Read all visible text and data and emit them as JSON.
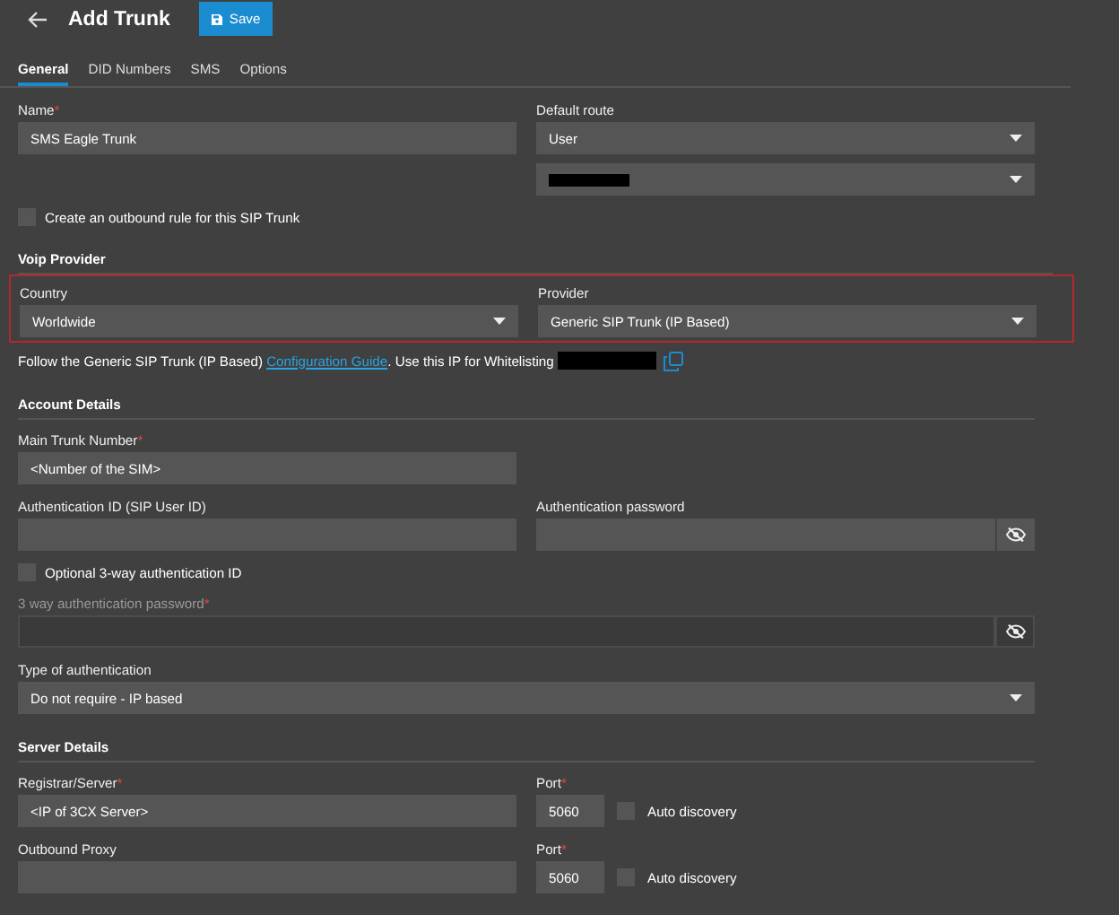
{
  "header": {
    "title": "Add Trunk",
    "save_label": "Save"
  },
  "required_marker": "*",
  "tabs": [
    {
      "label": "General",
      "selected": true
    },
    {
      "label": "DID Numbers",
      "selected": false
    },
    {
      "label": "SMS",
      "selected": false
    },
    {
      "label": "Options",
      "selected": false
    }
  ],
  "sections": [
    {
      "highlighted": false,
      "rows": [
        [
          {
            "kind": "text",
            "label": "Name",
            "required": true,
            "value": "SMS Eagle Trunk"
          },
          {
            "kind": "select",
            "label": "Default route",
            "required": false,
            "selects": [
              {
                "value": "User",
                "redacted": false
              },
              {
                "redacted": true
              }
            ]
          }
        ],
        [
          {
            "kind": "checkbox",
            "label": "Create an outbound rule for this SIP Trunk",
            "checked": false
          }
        ]
      ]
    },
    {
      "heading": "Voip Provider",
      "highlighted": true,
      "rows": [
        [
          {
            "kind": "select",
            "label": "Country",
            "required": false,
            "selects": [
              {
                "value": "Worldwide",
                "redacted": false
              }
            ]
          },
          {
            "kind": "select",
            "label": "Provider",
            "required": false,
            "selects": [
              {
                "value": "Generic SIP Trunk (IP Based)",
                "redacted": false
              }
            ]
          }
        ]
      ]
    },
    {
      "highlighted": false,
      "rows": [
        [
          {
            "kind": "note",
            "before": "Follow the Generic SIP Trunk (IP Based) ",
            "link": "Configuration Guide",
            "after": ". Use this IP for Whitelisting",
            "redacted": true
          }
        ]
      ]
    },
    {
      "heading": "Account Details",
      "highlighted": false,
      "rows": [
        [
          {
            "kind": "text",
            "label": "Main Trunk Number",
            "required": true,
            "value": "<Number of the SIM>"
          }
        ],
        [
          {
            "kind": "text",
            "label": "Authentication ID (SIP User ID)",
            "required": false
          },
          {
            "kind": "password",
            "label": "Authentication password",
            "required": false,
            "disabled": false,
            "wide": false
          }
        ],
        [
          {
            "kind": "checkbox",
            "label": "Optional 3-way authentication ID",
            "checked": false
          }
        ],
        [
          {
            "kind": "password",
            "label": "3 way authentication password",
            "required": true,
            "disabled": true,
            "wide": true
          }
        ],
        [
          {
            "kind": "select",
            "label": "Type of authentication",
            "required": false,
            "wide": true,
            "selects": [
              {
                "value": "Do not require - IP based",
                "redacted": false
              }
            ]
          }
        ]
      ]
    },
    {
      "heading": "Server Details",
      "highlighted": false,
      "rows": [
        [
          {
            "kind": "text",
            "label": "Registrar/Server",
            "required": true,
            "value": "<IP of 3CX Server>"
          },
          {
            "kind": "port",
            "label": "Port",
            "required": true,
            "value": "5060",
            "auto_label": "Auto discovery",
            "auto_checked": false
          }
        ],
        [
          {
            "kind": "text",
            "label": "Outbound Proxy",
            "required": false
          },
          {
            "kind": "port",
            "label": "Port",
            "required": true,
            "value": "5060",
            "auto_label": "Auto discovery",
            "auto_checked": false
          }
        ]
      ]
    }
  ]
}
